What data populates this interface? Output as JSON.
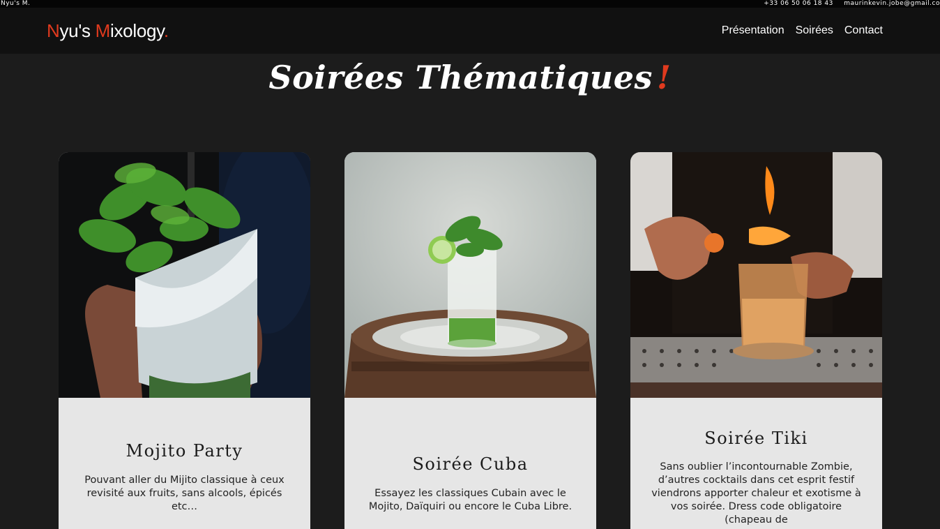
{
  "topbar": {
    "brand": "Nyu's M.",
    "phone": "+33 06 50 06 18 43",
    "email": "maurinkevin.jobe@gmail.co"
  },
  "header": {
    "logo_n": "N",
    "logo_part1": "yu's ",
    "logo_m": "M",
    "logo_part2": "ixology",
    "logo_dot": ".",
    "nav": [
      "Présentation",
      "Soirées",
      "Contact"
    ]
  },
  "main": {
    "title": "Soirées Thématiques",
    "title_mark": "!",
    "cards": [
      {
        "title": "Mojito Party",
        "text": "Pouvant aller du Mijito classique à ceux revisité aux fruits, sans alcools, épicés etc…",
        "image": "mojito-glass-photo"
      },
      {
        "title": "Soirée Cuba",
        "text": "Essayez les classiques Cubain avec le Mojito, Daïquiri ou encore le Cuba Libre.",
        "image": "cuba-glass-on-barrel-photo"
      },
      {
        "title": "Soirée Tiki",
        "text": "Sans oublier l’incontournable Zombie, d’autres cocktails dans cet esprit festif viendrons apporter chaleur et exotisme à vos soirée. Dress code obligatoire (chapeau de",
        "image": "flaming-orange-cocktail-photo"
      }
    ]
  },
  "colors": {
    "accent": "#e03a1e",
    "background": "#1c1c1c",
    "navbar": "#111111",
    "card": "#e6e6e6"
  }
}
